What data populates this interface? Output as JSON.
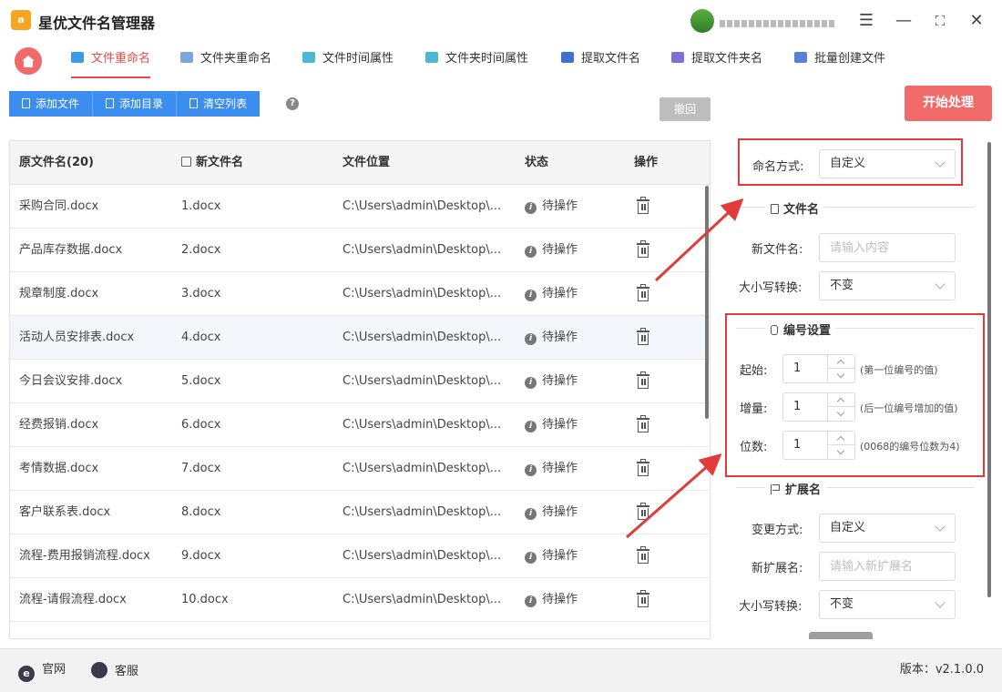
{
  "app": {
    "title": "星优文件名管理器",
    "logo_glyph": "a",
    "window_controls": {
      "settings": "☰",
      "minimize": "—",
      "maximize": "⛶",
      "close": "✕"
    }
  },
  "tabs": [
    {
      "label": "文件重命名",
      "active": true,
      "icon_color": "#3a9be8"
    },
    {
      "label": "文件夹重命名",
      "active": false,
      "icon_color": "#7aa7e0"
    },
    {
      "label": "文件时间属性",
      "active": false,
      "icon_color": "#4bb8d8"
    },
    {
      "label": "文件夹时间属性",
      "active": false,
      "icon_color": "#4bb8d8"
    },
    {
      "label": "提取文件名",
      "active": false,
      "icon_color": "#3f6fd0"
    },
    {
      "label": "提取文件夹名",
      "active": false,
      "icon_color": "#7d6fd8"
    },
    {
      "label": "批量创建文件",
      "active": false,
      "icon_color": "#5a7fd8"
    }
  ],
  "toolbar": {
    "add_file": "添加文件",
    "add_dir": "添加目录",
    "clear_list": "清空列表",
    "help": "?",
    "undo": "撤回",
    "start": "开始处理"
  },
  "table": {
    "headers": {
      "original": "原文件名(20)",
      "new_name": "新文件名",
      "location": "文件位置",
      "status": "状态",
      "action": "操作"
    },
    "rows": [
      {
        "original": "采购合同.docx",
        "new_name": "1.docx",
        "location": "C:\\Users\\admin\\Desktop\\...",
        "status": "待操作"
      },
      {
        "original": "产品库存数据.docx",
        "new_name": "2.docx",
        "location": "C:\\Users\\admin\\Desktop\\...",
        "status": "待操作"
      },
      {
        "original": "规章制度.docx",
        "new_name": "3.docx",
        "location": "C:\\Users\\admin\\Desktop\\...",
        "status": "待操作"
      },
      {
        "original": "活动人员安排表.docx",
        "new_name": "4.docx",
        "location": "C:\\Users\\admin\\Desktop\\...",
        "status": "待操作"
      },
      {
        "original": "今日会议安排.docx",
        "new_name": "5.docx",
        "location": "C:\\Users\\admin\\Desktop\\...",
        "status": "待操作"
      },
      {
        "original": "经费报销.docx",
        "new_name": "6.docx",
        "location": "C:\\Users\\admin\\Desktop\\...",
        "status": "待操作"
      },
      {
        "original": "考情数据.docx",
        "new_name": "7.docx",
        "location": "C:\\Users\\admin\\Desktop\\...",
        "status": "待操作"
      },
      {
        "original": "客户联系表.docx",
        "new_name": "8.docx",
        "location": "C:\\Users\\admin\\Desktop\\...",
        "status": "待操作"
      },
      {
        "original": "流程-费用报销流程.docx",
        "new_name": "9.docx",
        "location": "C:\\Users\\admin\\Desktop\\...",
        "status": "待操作"
      },
      {
        "original": "流程-请假流程.docx",
        "new_name": "10.docx",
        "location": "C:\\Users\\admin\\Desktop\\...",
        "status": "待操作"
      }
    ]
  },
  "panel": {
    "naming_mode": {
      "label": "命名方式:",
      "value": "自定义"
    },
    "filename_section": {
      "title": "文件名",
      "new_name_label": "新文件名:",
      "new_name_placeholder": "请输入内容",
      "case_label": "大小写转换:",
      "case_value": "不变"
    },
    "numbering_section": {
      "title": "编号设置",
      "start": {
        "label": "起始:",
        "value": "1",
        "hint": "(第一位编号的值)"
      },
      "step": {
        "label": "增量:",
        "value": "1",
        "hint": "(后一位编号增加的值)"
      },
      "digits": {
        "label": "位数:",
        "value": "1",
        "hint": "(0068的编号位数为4)"
      }
    },
    "extension_section": {
      "title": "扩展名",
      "mode_label": "变更方式:",
      "mode_value": "自定义",
      "new_ext_label": "新扩展名:",
      "new_ext_placeholder": "请输入新扩展名",
      "case_label": "大小写转换:",
      "case_value": "不变"
    }
  },
  "footer": {
    "website": "官网",
    "website_icon": "e",
    "support": "客服",
    "version": "版本：v2.1.0.0"
  },
  "colors": {
    "accent_red": "#e24c4c",
    "button_blue": "#3b8df0",
    "start_button": "#f06a6a",
    "annotation_red": "#e23b3b"
  }
}
